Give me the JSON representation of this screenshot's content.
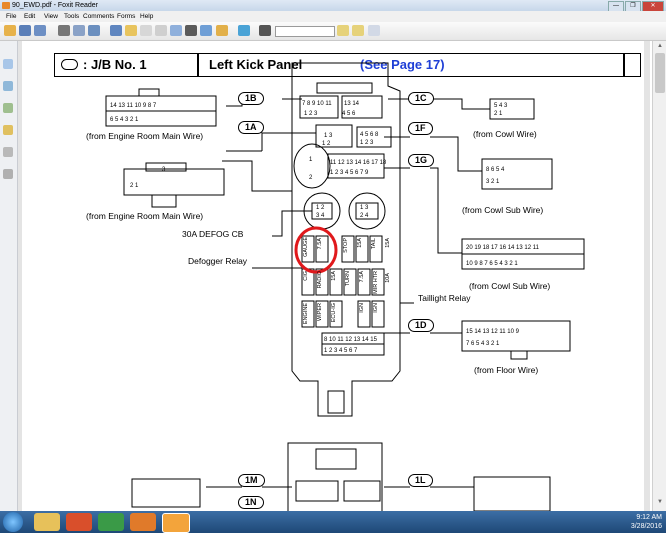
{
  "window": {
    "title": "90_EWD.pdf - Foxit Reader",
    "controls": [
      "—",
      "❐",
      "✕"
    ]
  },
  "menu": {
    "items": [
      "File",
      "Edit",
      "View",
      "Tools",
      "Comments",
      "Forms",
      "Help"
    ]
  },
  "diagram": {
    "header_jb": ": J/B No. 1",
    "header_panel": "Left Kick Panel",
    "header_see": "(See Page 17)",
    "tags": {
      "t1B": "1B",
      "t1A": "1A",
      "t1C": "1C",
      "t1F": "1F",
      "t1G": "1G",
      "t1D": "1D",
      "t1M": "1M",
      "t1N": "1N",
      "t1L": "1L"
    },
    "labels": {
      "from_engine_room_main_1": "(from Engine Room Main Wire)",
      "from_engine_room_main_2": "(from Engine Room Main Wire)",
      "from_cowl": "(from Cowl Wire)",
      "from_cowl_sub_1": "(from Cowl Sub Wire)",
      "from_cowl_sub_2": "(from Cowl Sub Wire)",
      "from_floor": "(from Floor Wire)",
      "defog_cb": "30A DEFOG CB",
      "defogger_relay": "Defogger Relay",
      "taillight_relay": "Taillight Relay"
    },
    "fuses": {
      "gauge": "GAUGE",
      "a7_5": "7.5A",
      "stop": "STOP",
      "a15": "15A",
      "tail": "TAIL",
      "a15b": "15A",
      "cig": "CIG",
      "radio": "RADIO",
      "a15c": "15A",
      "turn": "TURN",
      "a7_5b": "7.5A",
      "mirhtr": "MIR HTR",
      "a10": "10A",
      "igh": "IGN",
      "engine": "ENGINE",
      "wiper": "WIPER",
      "ecuig": "ECU-IG",
      "ign": "IGN"
    }
  },
  "taskbar": {
    "time": "9:12 AM",
    "date": "3/28/2016"
  }
}
